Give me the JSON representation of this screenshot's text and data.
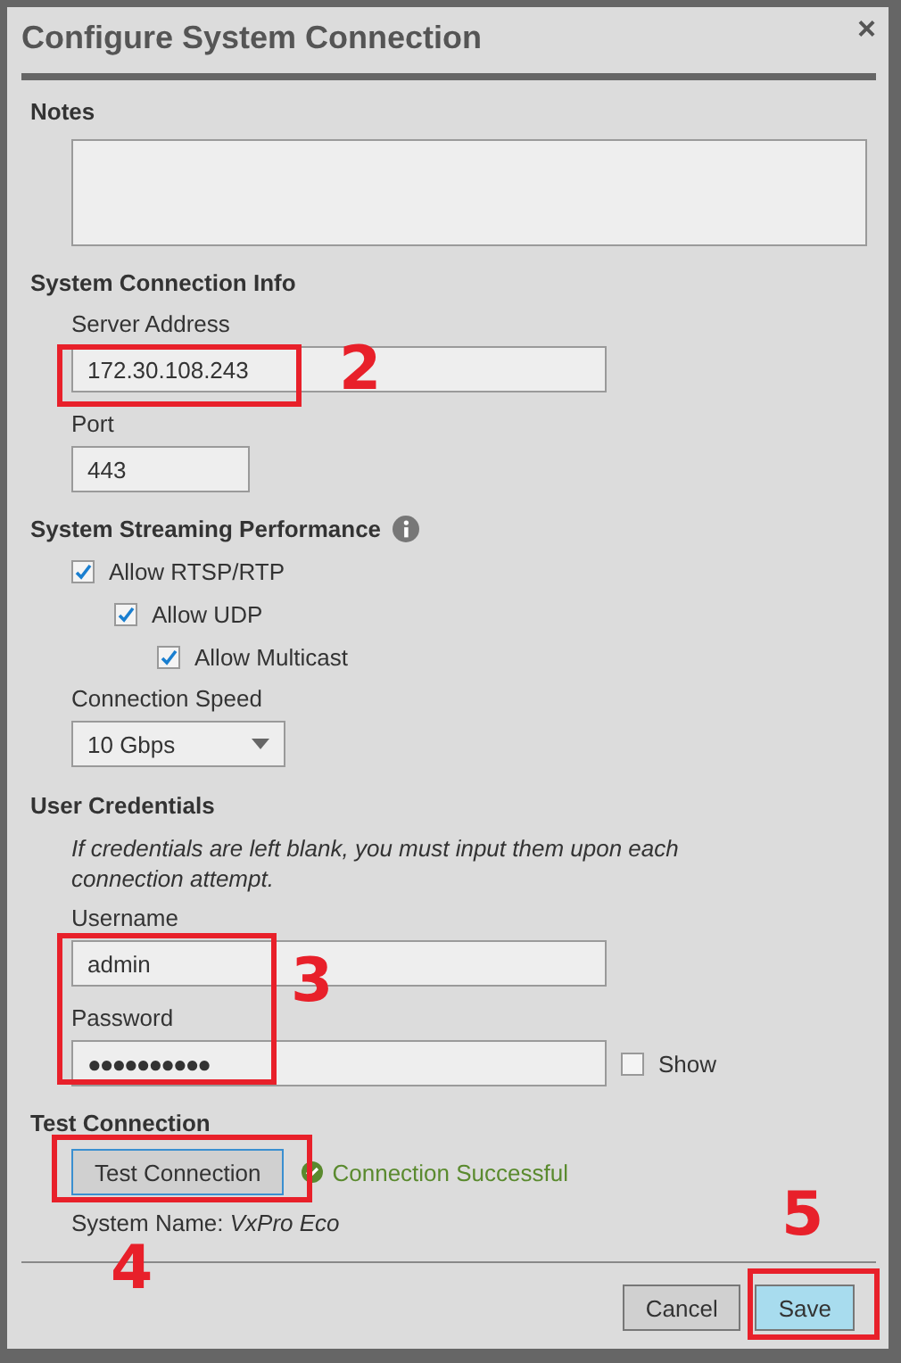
{
  "dialog": {
    "title": "Configure System Connection",
    "close": "×"
  },
  "notes": {
    "heading": "Notes"
  },
  "connection_info": {
    "heading": "System Connection Info",
    "server_label": "Server Address",
    "server_value": "172.30.108.243",
    "port_label": "Port",
    "port_value": "443"
  },
  "streaming": {
    "heading": "System Streaming Performance",
    "options": [
      {
        "label": "Allow RTSP/RTP",
        "checked": true,
        "children": [
          {
            "label": "Allow UDP",
            "checked": true,
            "children": [
              {
                "label": "Allow Multicast",
                "checked": true
              }
            ]
          }
        ]
      }
    ],
    "speed_label": "Connection Speed",
    "speed_value": "10 Gbps"
  },
  "credentials": {
    "heading": "User Credentials",
    "note": "If credentials are left blank, you must input them upon each connection attempt.",
    "username_label": "Username",
    "username_value": "admin",
    "password_label": "Password",
    "password_value": "●●●●●●●●●●",
    "show_label": "Show",
    "show_checked": false
  },
  "test": {
    "heading": "Test Connection",
    "button": "Test Connection",
    "status": "Connection Successful",
    "system_name_label": "System Name:",
    "system_name_value": "VxPro Eco"
  },
  "buttons": [
    {
      "label": "Cancel",
      "kind": "secondary"
    },
    {
      "label": "Save",
      "kind": "primary"
    }
  ],
  "annotations": [
    {
      "number": "2"
    },
    {
      "number": "3"
    },
    {
      "number": "4"
    },
    {
      "number": "5"
    }
  ]
}
